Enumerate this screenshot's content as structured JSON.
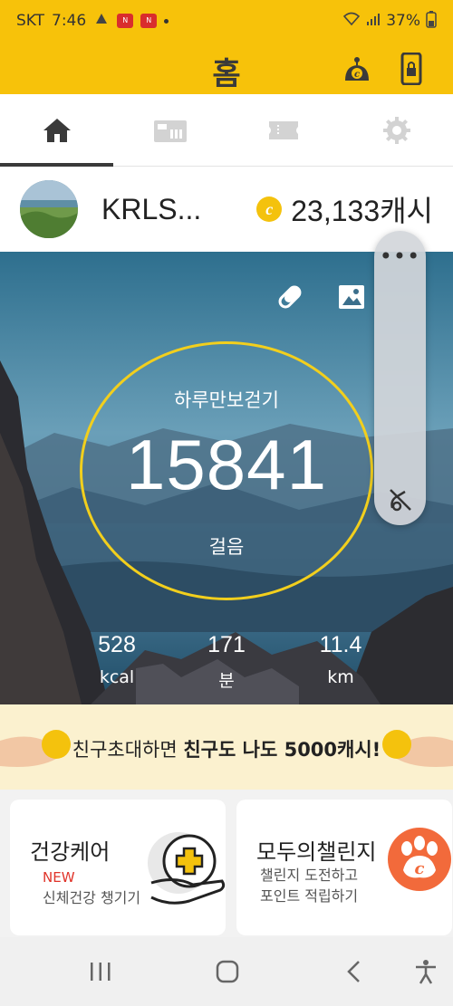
{
  "status_bar": {
    "carrier": "SKT",
    "time": "7:46",
    "battery": "37%"
  },
  "header": {
    "title": "홈"
  },
  "tabs": [
    {
      "name": "home",
      "icon": "home-icon",
      "active": true
    },
    {
      "name": "shopping",
      "icon": "store-icon",
      "active": false
    },
    {
      "name": "coupon",
      "icon": "ticket-icon",
      "active": false
    },
    {
      "name": "settings",
      "icon": "gear-icon",
      "active": false
    }
  ],
  "profile": {
    "username": "KRLS...",
    "cash": "23,133캐시"
  },
  "pedometer": {
    "label": "하루만보걷기",
    "steps": "15841",
    "unit": "걸음",
    "stats": [
      {
        "value": "528",
        "unit": "kcal"
      },
      {
        "value": "171",
        "unit": "분"
      },
      {
        "value": "11.4",
        "unit": "km"
      }
    ]
  },
  "overlay": {
    "more": "•••"
  },
  "banner": {
    "text_normal": "친구초대하면 ",
    "text_bold": "친구도 나도 5000캐시!"
  },
  "cards": {
    "health": {
      "title": "건강케어",
      "badge": "NEW",
      "subtitle": "신체건강 챙기기"
    },
    "challenge": {
      "title": "모두의챌린지",
      "subtitle_line1": "챌린지 도전하고",
      "subtitle_line2": "포인트 적립하기"
    }
  },
  "colors": {
    "brand_yellow": "#f7c20a",
    "coin": "#f4c20d",
    "accent_orange": "#f26a3b",
    "new_red": "#e0342a"
  }
}
